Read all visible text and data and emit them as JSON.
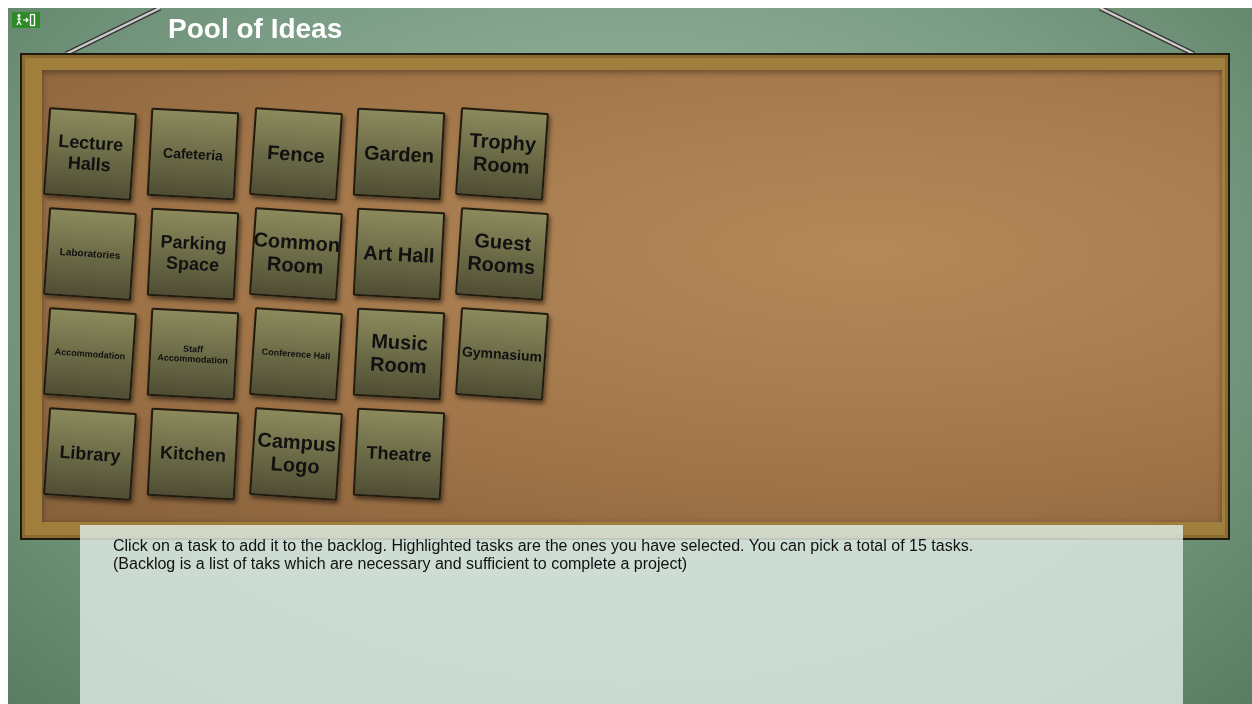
{
  "title": "Pool of Ideas",
  "tasks": [
    {
      "label": "Lecture Halls",
      "selected": false
    },
    {
      "label": "Cafeteria",
      "selected": false
    },
    {
      "label": "Fence",
      "selected": false
    },
    {
      "label": "Garden",
      "selected": false
    },
    {
      "label": "Trophy Room",
      "selected": false
    },
    {
      "label": "Laboratories",
      "selected": false
    },
    {
      "label": "Parking Space",
      "selected": false
    },
    {
      "label": "Common Room",
      "selected": false
    },
    {
      "label": "Art Hall",
      "selected": false
    },
    {
      "label": "Guest Rooms",
      "selected": false
    },
    {
      "label": "Accommodation",
      "selected": false
    },
    {
      "label": "Staff Accommodation",
      "selected": false
    },
    {
      "label": "Conference Hall",
      "selected": false
    },
    {
      "label": "Music Room",
      "selected": false
    },
    {
      "label": "Gymnasium",
      "selected": false
    },
    {
      "label": "Library",
      "selected": false
    },
    {
      "label": "Kitchen",
      "selected": false
    },
    {
      "label": "Campus Logo",
      "selected": false
    },
    {
      "label": "Theatre",
      "selected": false
    }
  ],
  "instructions": [
    "Click on a task to add it to the backlog. Highlighted tasks are the ones you have selected. You can pick a total of 15 tasks.",
    "(Backlog is a list of taks which are necessary and sufficient to complete a project)"
  ]
}
